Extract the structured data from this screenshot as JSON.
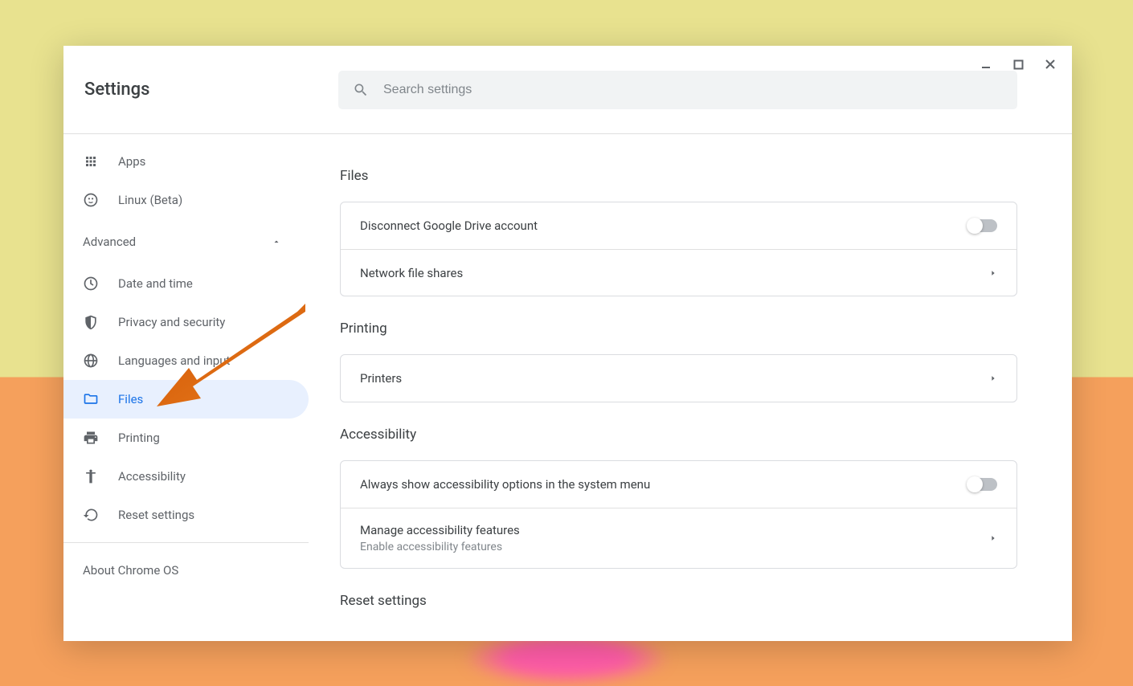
{
  "header": {
    "title": "Settings",
    "search_placeholder": "Search settings"
  },
  "sidebar": {
    "items_top": [
      {
        "label": "Apps",
        "icon": "apps"
      },
      {
        "label": "Linux (Beta)",
        "icon": "linux"
      }
    ],
    "advanced_label": "Advanced",
    "items_advanced": [
      {
        "label": "Date and time",
        "icon": "clock"
      },
      {
        "label": "Privacy and security",
        "icon": "shield"
      },
      {
        "label": "Languages and input",
        "icon": "globe"
      },
      {
        "label": "Files",
        "icon": "folder",
        "active": true
      },
      {
        "label": "Printing",
        "icon": "printer"
      },
      {
        "label": "Accessibility",
        "icon": "accessibility"
      },
      {
        "label": "Reset settings",
        "icon": "reset"
      }
    ],
    "about_label": "About Chrome OS"
  },
  "sections": {
    "files": {
      "title": "Files",
      "rows": [
        {
          "label": "Disconnect Google Drive account",
          "type": "toggle",
          "value": false
        },
        {
          "label": "Network file shares",
          "type": "link"
        }
      ]
    },
    "printing": {
      "title": "Printing",
      "rows": [
        {
          "label": "Printers",
          "type": "link"
        }
      ]
    },
    "accessibility": {
      "title": "Accessibility",
      "rows": [
        {
          "label": "Always show accessibility options in the system menu",
          "type": "toggle",
          "value": false
        },
        {
          "label": "Manage accessibility features",
          "sublabel": "Enable accessibility features",
          "type": "link"
        }
      ]
    },
    "reset": {
      "title": "Reset settings"
    }
  }
}
